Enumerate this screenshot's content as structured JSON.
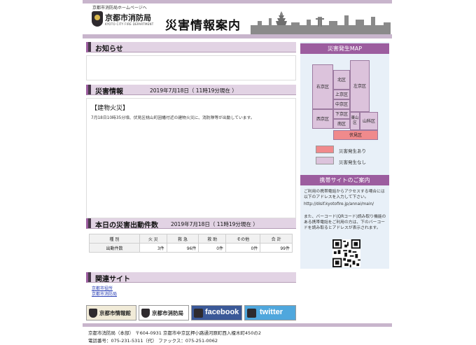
{
  "header": {
    "home_link": "京都市消防局ホームページへ",
    "logo_name": "京都市消防局",
    "logo_sub": "KYOTO CITY FIRE DEPARTMENT",
    "page_title": "災害情報案内"
  },
  "notice": {
    "title": "お知らせ"
  },
  "disaster": {
    "title": "災害情報",
    "date": "2019年7月18日（ 11時19分現在 ）",
    "type": "【建物火災】",
    "text": "7月18日10時35分頃、伏見区桃山町因幡付近の建物火災に、消防隊等が出動しています。"
  },
  "dispatch": {
    "title": "本日の災害出動件数",
    "date": "2019年7月18日（ 11時19分現在 ）",
    "headers": [
      "種 別",
      "火 災",
      "救 急",
      "救 助",
      "その他",
      "合 計"
    ],
    "row_label": "出動件数",
    "values": [
      "3件",
      "96件",
      "0件",
      "0件",
      "99件"
    ]
  },
  "related": {
    "title": "関連サイト",
    "links": [
      "京都市役所",
      "京都市消防局"
    ],
    "banners": [
      "京都市情報館",
      "京都市消防局",
      "facebook",
      "twitter"
    ]
  },
  "map": {
    "title": "災害発生MAP",
    "wards": {
      "kita": "北区",
      "sakyo": "左京区",
      "ukyo": "右京区",
      "kamigyo": "上京区",
      "nakagyo": "中京区",
      "shimogyo": "下京区",
      "nishikyo": "西京区",
      "minami": "南区",
      "higashiyama": "東山区",
      "yamashina": "山科区",
      "fushimi": "伏見区"
    },
    "legend_active": "災害発生あり",
    "legend_none": "災害発生なし",
    "colors": {
      "active": "#f08a8c",
      "none": "#dcc3dc"
    }
  },
  "mobile": {
    "title": "携帯サイトのご案内",
    "text1": "ご利用の携帯電話からアクセスする場合には以下のアドレスを入力して下さい。",
    "url": "http://disif.kyotofire.jp/annai/main/",
    "text2": "また、バーコード(QRコード)読み取り機能のある携帯電話をご利用の方は、下のバーコードを読み取るとアドレスが表示されます。"
  },
  "footer": {
    "line1": "京都市消防局（本部） 〒604-0931 京都市中京区押小路通河原町西入榎木町450の2",
    "line2": "電話番号：075-231-5311（代） ファックス：075-251-0062"
  }
}
